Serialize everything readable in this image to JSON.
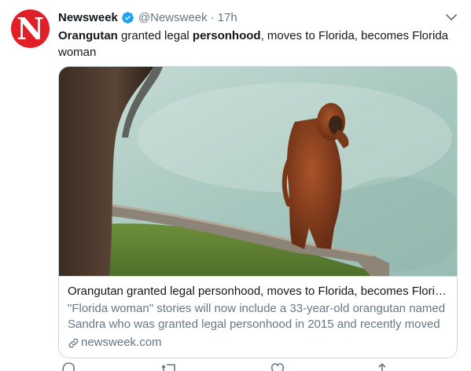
{
  "tweet": {
    "author_name": "Newsweek",
    "handle": "@Newsweek",
    "separator": "·",
    "time": "17h",
    "text_segments": [
      {
        "text": "Orangutan",
        "bold": true
      },
      {
        "text": " granted legal ",
        "bold": false
      },
      {
        "text": "personhood",
        "bold": true
      },
      {
        "text": ", moves to Florida, becomes Florida woman",
        "bold": false
      }
    ]
  },
  "avatar": {
    "glyph": "N",
    "background": "#e01f26"
  },
  "card": {
    "title": "Orangutan granted legal personhood, moves to Florida, becomes Florida woman",
    "description": "\"Florida woman\" stories will now include a 33-year-old orangutan named Sandra who was granted legal personhood in 2015 and recently moved ...",
    "domain": "newsweek.com"
  },
  "actions": {
    "reply_count": "",
    "retweet_count": "",
    "like_count": ""
  },
  "colors": {
    "text": "#14171a",
    "secondary": "#657786",
    "verified": "#1da1f2",
    "border": "#ccd6dd"
  },
  "icons": {
    "verified": "verified-badge-icon",
    "caret": "chevron-down-icon",
    "link": "link-icon",
    "reply": "reply-icon",
    "retweet": "retweet-icon",
    "like": "heart-icon",
    "share": "share-icon"
  }
}
